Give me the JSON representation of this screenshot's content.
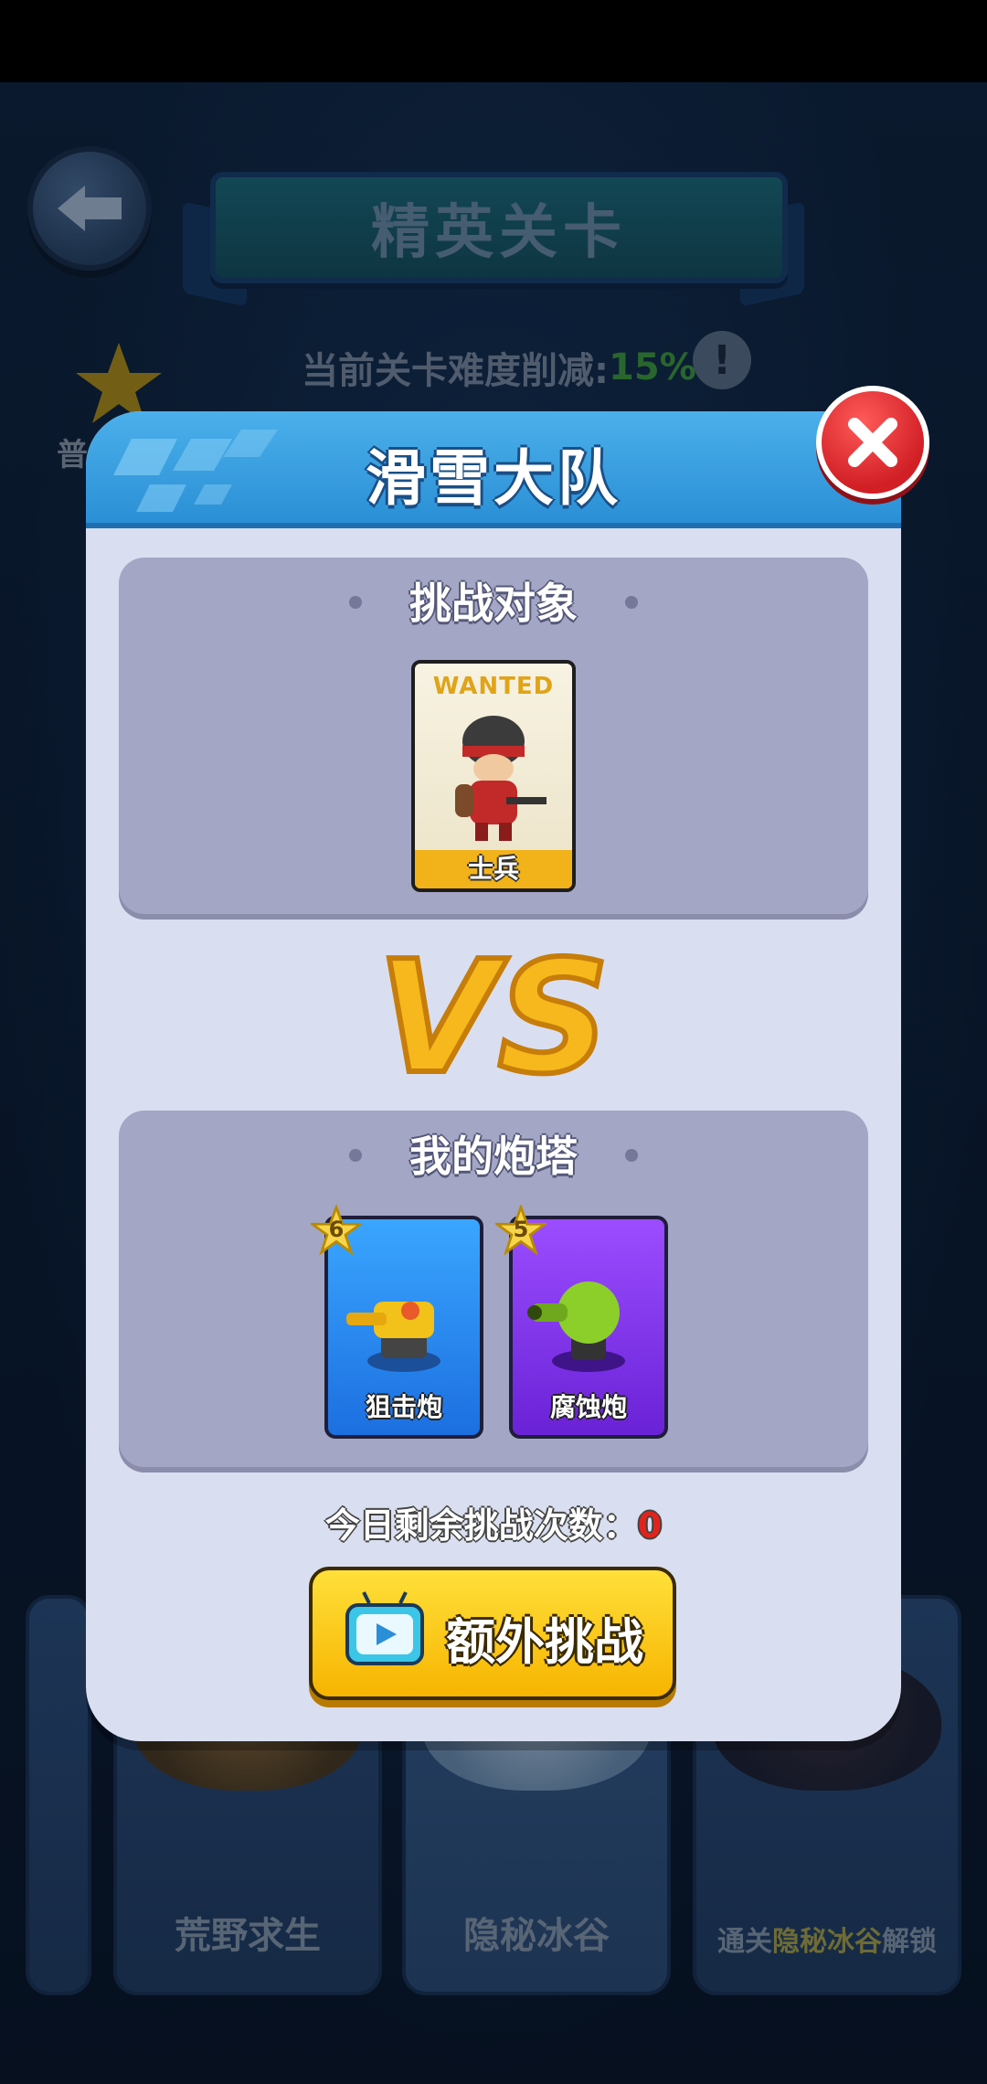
{
  "header": {
    "title": "精英关卡",
    "difficulty_label": "当前关卡难度削减:",
    "difficulty_value": "15%",
    "side_label": "普"
  },
  "maps": [
    {
      "name": "荒野求生"
    },
    {
      "name": "隐秘冰谷"
    },
    {
      "name_prefix": "通关",
      "name_highlight": "隐秘冰谷",
      "name_suffix": "解锁"
    }
  ],
  "modal": {
    "title": "滑雪大队",
    "challenge_section": {
      "title": "挑战对象",
      "enemy": {
        "badge": "WANTED",
        "name": "士兵"
      }
    },
    "vs_text": "VS",
    "towers_section": {
      "title": "我的炮塔",
      "towers": [
        {
          "name": "狙击炮",
          "stars": "6",
          "color": "#1c6fe0"
        },
        {
          "name": "腐蚀炮",
          "stars": "5",
          "color": "#6a22d6"
        }
      ]
    },
    "remaining_label": "今日剩余挑战次数：",
    "remaining_count": "0",
    "extra_button_label": "额外挑战"
  },
  "colors": {
    "header_blue": "#2b8fd6",
    "close_red": "#d11f25",
    "button_yellow": "#f7b400",
    "percent_green": "#3f9a3f"
  }
}
